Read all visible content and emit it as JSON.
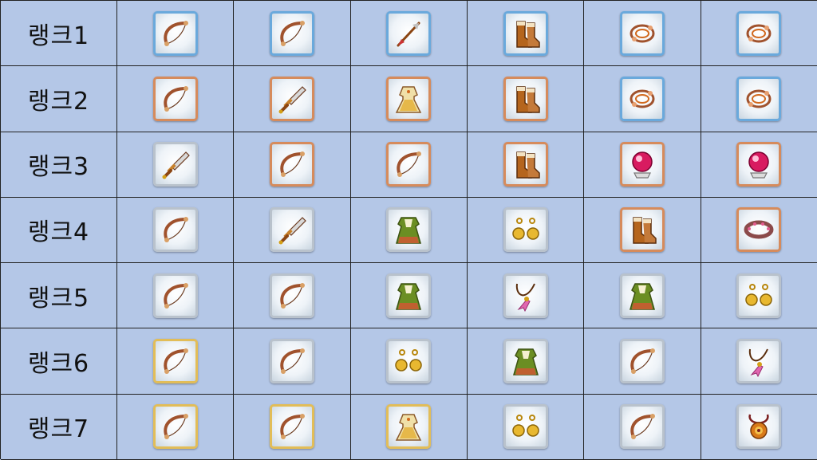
{
  "ranks": [
    {
      "label": "랭크1",
      "items": [
        {
          "icon": "bow-icon",
          "tier": "blue"
        },
        {
          "icon": "bow-icon",
          "tier": "blue"
        },
        {
          "icon": "arrow-icon",
          "tier": "blue"
        },
        {
          "icon": "boots-icon",
          "tier": "blue"
        },
        {
          "icon": "bracelet-icon",
          "tier": "blue"
        },
        {
          "icon": "bracelet-icon",
          "tier": "blue"
        }
      ]
    },
    {
      "label": "랭크2",
      "items": [
        {
          "icon": "bow-icon",
          "tier": "copper"
        },
        {
          "icon": "dagger-icon",
          "tier": "copper"
        },
        {
          "icon": "dress-icon",
          "tier": "copper"
        },
        {
          "icon": "boots-icon",
          "tier": "copper"
        },
        {
          "icon": "bracelet-icon",
          "tier": "blue"
        },
        {
          "icon": "bracelet-icon",
          "tier": "blue"
        }
      ]
    },
    {
      "label": "랭크3",
      "items": [
        {
          "icon": "dagger-icon",
          "tier": "silver"
        },
        {
          "icon": "bow-icon",
          "tier": "copper"
        },
        {
          "icon": "bow-icon",
          "tier": "copper"
        },
        {
          "icon": "boots-icon",
          "tier": "copper"
        },
        {
          "icon": "orb-icon",
          "tier": "copper"
        },
        {
          "icon": "orb-icon",
          "tier": "copper"
        }
      ]
    },
    {
      "label": "랭크4",
      "items": [
        {
          "icon": "bow-icon",
          "tier": "silver"
        },
        {
          "icon": "dagger-icon",
          "tier": "silver"
        },
        {
          "icon": "robe-icon",
          "tier": "silver"
        },
        {
          "icon": "earrings-icon",
          "tier": "silver"
        },
        {
          "icon": "boots-icon",
          "tier": "copper"
        },
        {
          "icon": "bangle-icon",
          "tier": "copper"
        }
      ]
    },
    {
      "label": "랭크5",
      "items": [
        {
          "icon": "bow-icon",
          "tier": "silver"
        },
        {
          "icon": "bow-icon",
          "tier": "silver"
        },
        {
          "icon": "robe-icon",
          "tier": "silver"
        },
        {
          "icon": "necklace-icon",
          "tier": "silver"
        },
        {
          "icon": "robe-icon",
          "tier": "silver"
        },
        {
          "icon": "earrings-icon",
          "tier": "silver"
        }
      ]
    },
    {
      "label": "랭크6",
      "items": [
        {
          "icon": "bow-icon",
          "tier": "gold"
        },
        {
          "icon": "bow-icon",
          "tier": "silver"
        },
        {
          "icon": "earrings-icon",
          "tier": "silver"
        },
        {
          "icon": "robe-icon",
          "tier": "silver"
        },
        {
          "icon": "bow-icon",
          "tier": "silver"
        },
        {
          "icon": "necklace-icon",
          "tier": "silver"
        }
      ]
    },
    {
      "label": "랭크7",
      "items": [
        {
          "icon": "bow-icon",
          "tier": "gold"
        },
        {
          "icon": "bow-icon",
          "tier": "gold"
        },
        {
          "icon": "dress-icon",
          "tier": "gold"
        },
        {
          "icon": "earrings-icon",
          "tier": "silver"
        },
        {
          "icon": "bow-icon",
          "tier": "silver"
        },
        {
          "icon": "amulet-icon",
          "tier": "silver"
        }
      ]
    }
  ],
  "colors": {
    "background": "#b4c7e7",
    "grid_line": "#222222",
    "tier_blue": "#6aa9dc",
    "tier_copper": "#d68b5c",
    "tier_silver": "#b9c2cc",
    "tier_gold": "#e2bd58"
  }
}
